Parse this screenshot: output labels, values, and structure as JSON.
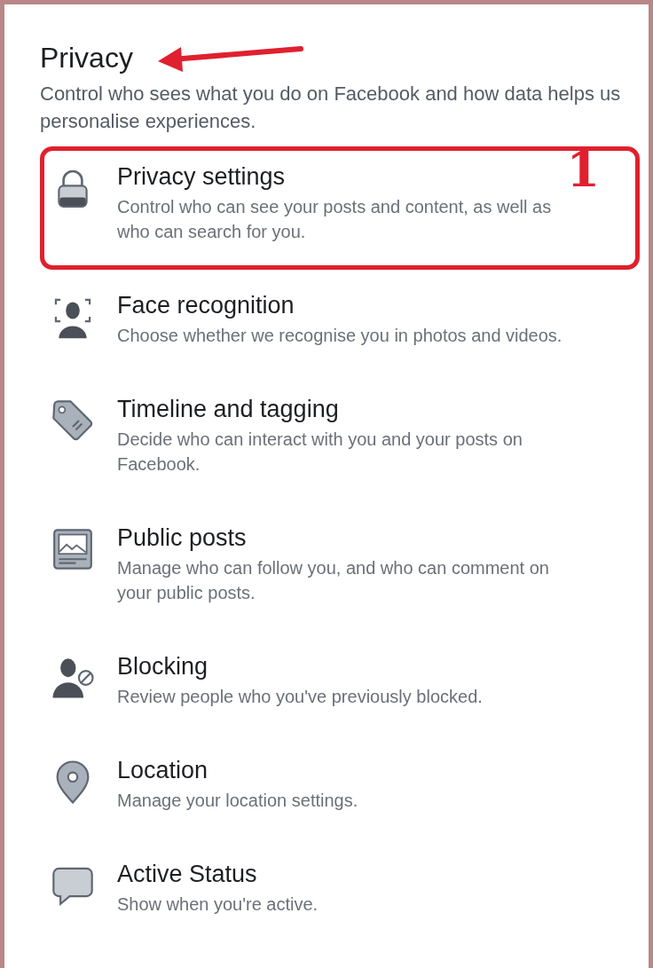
{
  "header": {
    "title": "Privacy",
    "description": "Control who sees what you do on Facebook and how data helps us personalise experiences.",
    "arrow": true
  },
  "items": [
    {
      "kind": "lock",
      "title": "Privacy settings",
      "description": "Control who can see your posts and content, as well as who can search for you.",
      "highlighted": true,
      "annotation": "1"
    },
    {
      "kind": "face",
      "title": "Face recognition",
      "description": "Choose whether we recognise you in photos and videos.",
      "highlighted": false
    },
    {
      "kind": "tag",
      "title": "Timeline and tagging",
      "description": "Decide who can interact with you and your posts on Facebook.",
      "highlighted": false
    },
    {
      "kind": "post",
      "title": "Public posts",
      "description": "Manage who can follow you, and who can comment on your public posts.",
      "highlighted": false
    },
    {
      "kind": "block",
      "title": "Blocking",
      "description": "Review people who you've previously blocked.",
      "highlighted": false
    },
    {
      "kind": "pin",
      "title": "Location",
      "description": "Manage your location settings.",
      "highlighted": false
    },
    {
      "kind": "chat",
      "title": "Active Status",
      "description": "Show when you're active.",
      "highlighted": false
    }
  ]
}
